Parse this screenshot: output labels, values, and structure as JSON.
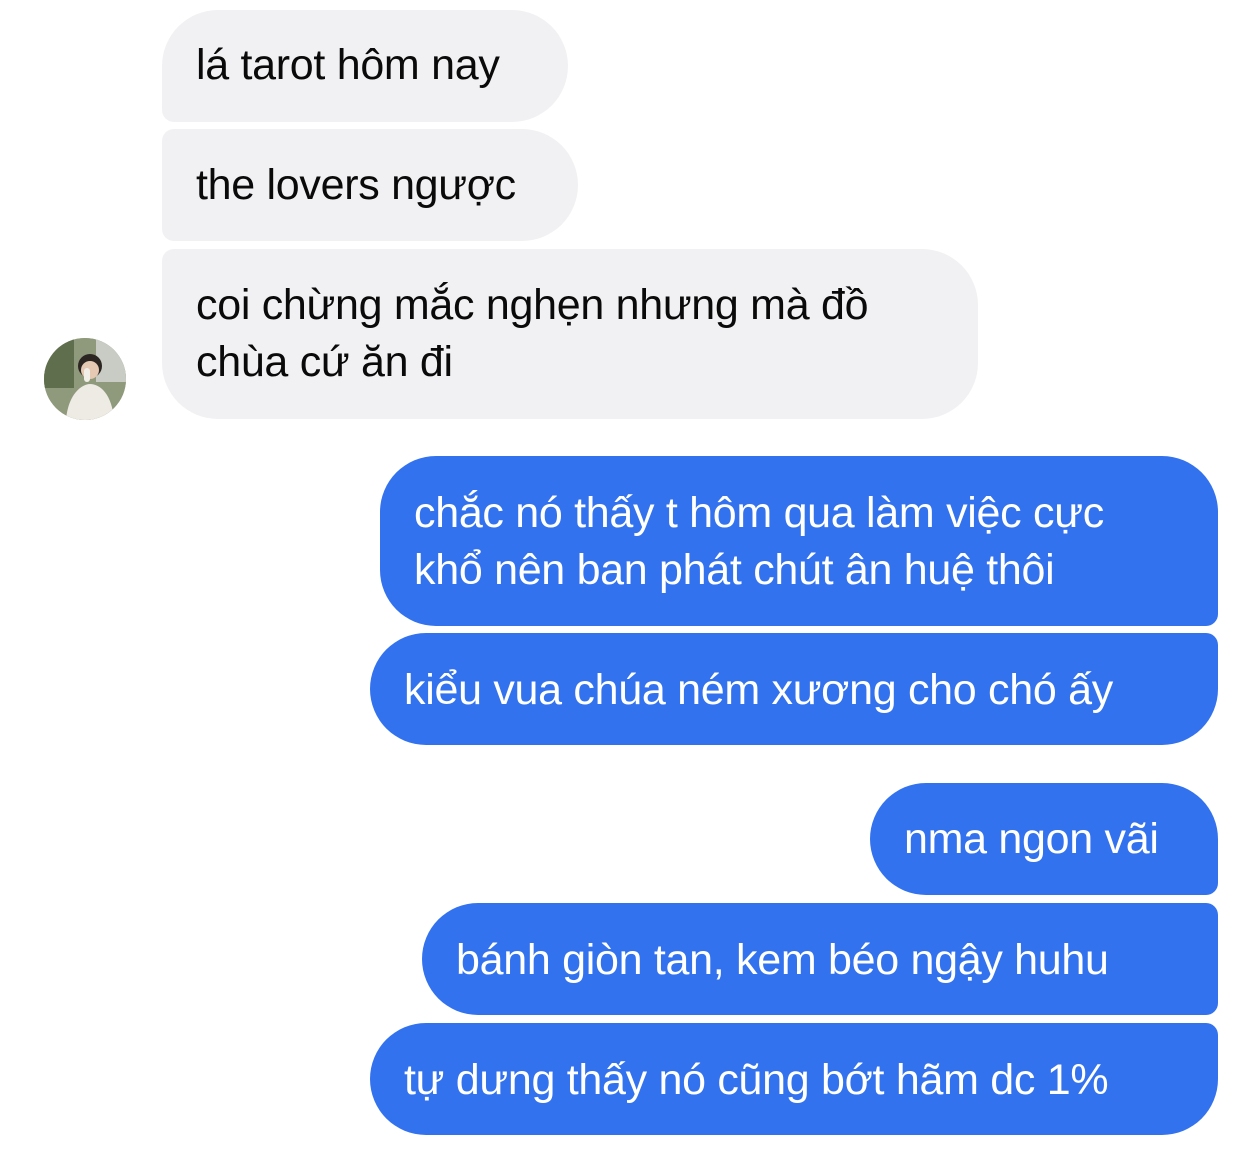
{
  "chat": {
    "received": [
      "lá tarot hôm nay",
      "the lovers ngược",
      "coi chừng mắc nghẹn nhưng mà đồ",
      "chùa cứ ăn đi"
    ],
    "sent": [
      "chắc nó thấy t hôm qua làm việc cực",
      "khổ nên ban phát chút ân huệ thôi",
      "kiểu vua chúa ném xương cho chó ấy",
      "nma ngon vãi",
      "bánh giòn tan, kem béo ngậy huhu",
      "tự dưng thấy nó cũng bớt hãm dc 1%"
    ]
  },
  "colors": {
    "received_bubble": "#f1f1f3",
    "sent_bubble": "#3372ee",
    "sent_text": "#ffffff",
    "received_text": "#0a0a0a"
  }
}
